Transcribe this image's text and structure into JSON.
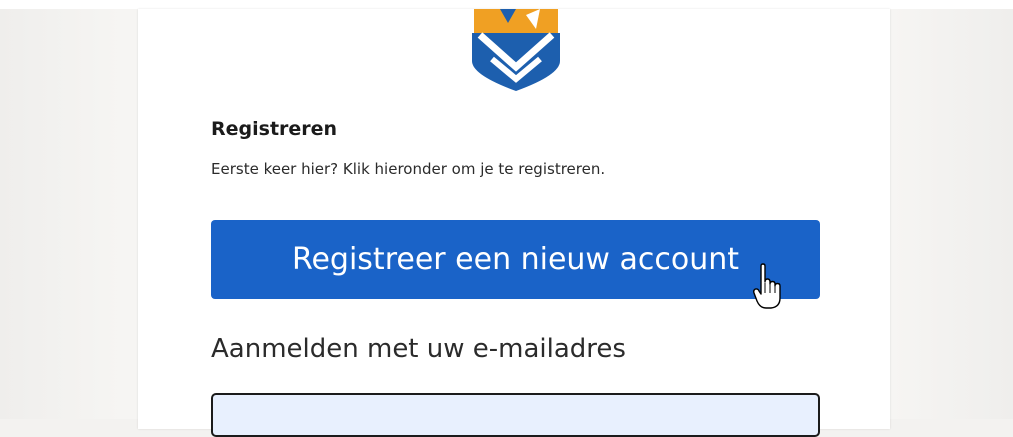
{
  "register": {
    "heading": "Registreren",
    "subtext": "Eerste keer hier? Klik hieronder om je te registreren.",
    "button_label": "Registreer een nieuw account"
  },
  "signin": {
    "heading": "Aanmelden met uw e-mailadres",
    "email_value": ""
  },
  "icons": {
    "logo": "shield-logo",
    "cursor": "hand-pointer-cursor-icon"
  },
  "colors": {
    "button": "#1a63c8",
    "input_autofill": "#e8f0fe",
    "logo_blue": "#1d5fae",
    "logo_orange": "#f0a023"
  }
}
